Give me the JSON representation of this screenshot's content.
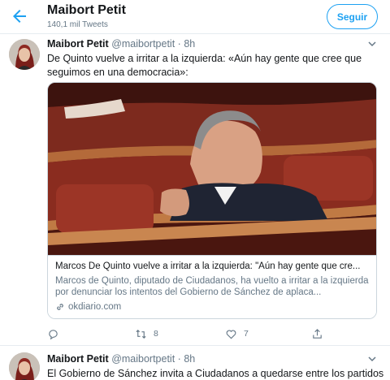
{
  "header": {
    "title": "Maibort Petit",
    "tweet_count": "140,1 mil Tweets",
    "follow_label": "Seguir"
  },
  "colors": {
    "accent": "#1da1f2",
    "secondary_text": "#657786",
    "border": "#e6ecf0"
  },
  "tweets": [
    {
      "name": "Maibort Petit",
      "handle": "@maibortpetit",
      "dot": "·",
      "time": "8h",
      "text": "De Quinto vuelve a irritar a la izquierda: «Aún hay gente que cree que seguimos en una democracia»:",
      "card": {
        "title": "Marcos De Quinto vuelve a irritar a la izquierda: \"Aún hay gente que cre...",
        "description": "Marcos de Quinto, diputado de Ciudadanos, ha vuelto a irritar a la izquierda por denunciar los intentos del Gobierno de Sánchez de aplaca...",
        "domain": "okdiario.com"
      },
      "actions": {
        "reply_count": "",
        "retweet_count": "8",
        "like_count": "7"
      }
    },
    {
      "name": "Maibort Petit",
      "handle": "@maibortpetit",
      "dot": "·",
      "time": "8h",
      "text": "El Gobierno de Sánchez invita a Ciudadanos a quedarse entre los partidos"
    }
  ],
  "icons": {
    "back": "back-arrow-icon",
    "caret": "chevron-down-icon",
    "reply": "reply-icon",
    "retweet": "retweet-icon",
    "like": "heart-icon",
    "share": "share-icon",
    "link": "link-icon"
  }
}
